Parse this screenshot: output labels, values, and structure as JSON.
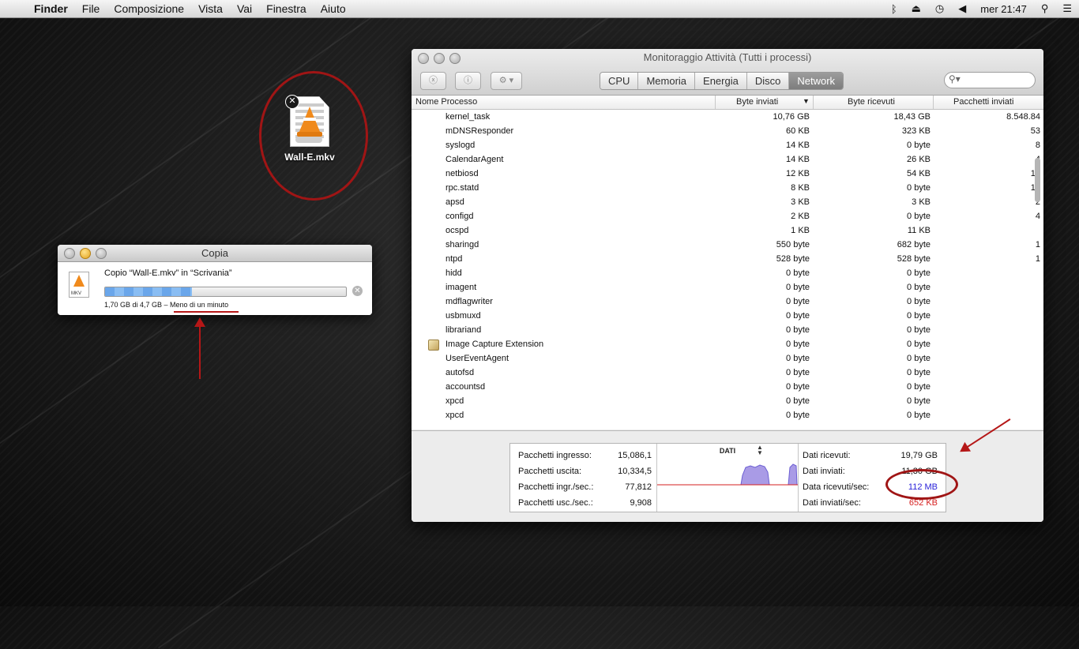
{
  "menubar": {
    "apple": "",
    "items": [
      "Finder",
      "File",
      "Composizione",
      "Vista",
      "Vai",
      "Finestra",
      "Aiuto"
    ],
    "clock": "mer 21:47",
    "icons": [
      "bluetooth-icon",
      "eject-icon",
      "time-machine-icon",
      "volume-icon",
      "spotlight-icon",
      "notification-list-icon"
    ]
  },
  "desktop": {
    "file_label": "Wall-E.mkv"
  },
  "copy_window": {
    "title": "Copia",
    "message": "Copio “Wall-E.mkv” in “Scrivania”",
    "status": "1,70 GB di 4,7 GB – Meno di un minuto",
    "icon_text": "MKV",
    "progress": 0.36
  },
  "activity_monitor": {
    "title": "Monitoraggio Attività (Tutti i processi)",
    "tabs": [
      {
        "label": "CPU",
        "active": false
      },
      {
        "label": "Memoria",
        "active": false
      },
      {
        "label": "Energia",
        "active": false
      },
      {
        "label": "Disco",
        "active": false
      },
      {
        "label": "Network",
        "active": true
      }
    ],
    "search_placeholder": "",
    "columns": [
      "Nome Processo",
      "Byte inviati",
      "Byte ricevuti",
      "Pacchetti inviati"
    ],
    "rows": [
      {
        "name": "kernel_task",
        "sent": "10,76 GB",
        "recv": "18,43 GB",
        "packets": "8.548.84"
      },
      {
        "name": "mDNSResponder",
        "sent": "60 KB",
        "recv": "323 KB",
        "packets": "53"
      },
      {
        "name": "syslogd",
        "sent": "14 KB",
        "recv": "0 byte",
        "packets": "8"
      },
      {
        "name": "CalendarAgent",
        "sent": "14 KB",
        "recv": "26 KB",
        "packets": "4"
      },
      {
        "name": "netbiosd",
        "sent": "12 KB",
        "recv": "54 KB",
        "packets": "12"
      },
      {
        "name": "rpc.statd",
        "sent": "8 KB",
        "recv": "0 byte",
        "packets": "13"
      },
      {
        "name": "apsd",
        "sent": "3 KB",
        "recv": "3 KB",
        "packets": "2"
      },
      {
        "name": "configd",
        "sent": "2 KB",
        "recv": "0 byte",
        "packets": "4"
      },
      {
        "name": "ocspd",
        "sent": "1 KB",
        "recv": "11 KB",
        "packets": ""
      },
      {
        "name": "sharingd",
        "sent": "550 byte",
        "recv": "682 byte",
        "packets": "1"
      },
      {
        "name": "ntpd",
        "sent": "528 byte",
        "recv": "528 byte",
        "packets": "1"
      },
      {
        "name": "hidd",
        "sent": "0 byte",
        "recv": "0 byte",
        "packets": ""
      },
      {
        "name": "imagent",
        "sent": "0 byte",
        "recv": "0 byte",
        "packets": ""
      },
      {
        "name": "mdflagwriter",
        "sent": "0 byte",
        "recv": "0 byte",
        "packets": ""
      },
      {
        "name": "usbmuxd",
        "sent": "0 byte",
        "recv": "0 byte",
        "packets": ""
      },
      {
        "name": "librariand",
        "sent": "0 byte",
        "recv": "0 byte",
        "packets": ""
      },
      {
        "name": "Image Capture Extension",
        "sent": "0 byte",
        "recv": "0 byte",
        "packets": "",
        "has_icon": true
      },
      {
        "name": "UserEventAgent",
        "sent": "0 byte",
        "recv": "0 byte",
        "packets": ""
      },
      {
        "name": "autofsd",
        "sent": "0 byte",
        "recv": "0 byte",
        "packets": ""
      },
      {
        "name": "accountsd",
        "sent": "0 byte",
        "recv": "0 byte",
        "packets": ""
      },
      {
        "name": "xpcd",
        "sent": "0 byte",
        "recv": "0 byte",
        "packets": ""
      },
      {
        "name": "xpcd",
        "sent": "0 byte",
        "recv": "0 byte",
        "packets": ""
      }
    ],
    "stats_left": [
      {
        "label": "Pacchetti ingresso:",
        "value": "15,086,1"
      },
      {
        "label": "Pacchetti uscita:",
        "value": "10,334,5"
      },
      {
        "label": "Pacchetti ingr./sec.:",
        "value": "77,812"
      },
      {
        "label": "Pacchetti usc./sec.:",
        "value": "9,908"
      }
    ],
    "graph_title": "DATI",
    "stats_right": [
      {
        "label": "Dati ricevuti:",
        "value": "19,79 GB"
      },
      {
        "label": "Dati inviati:",
        "value": "11,30 GB"
      },
      {
        "label": "Data ricevuti/sec:",
        "value": "112 MB"
      },
      {
        "label": "Dati inviati/sec:",
        "value": "652 KB"
      }
    ]
  },
  "colors": {
    "annotation_red": "#b51717",
    "received_blue": "#2a22d9",
    "sent_red": "#d61f1f",
    "graph_fill": "#a99be6"
  }
}
